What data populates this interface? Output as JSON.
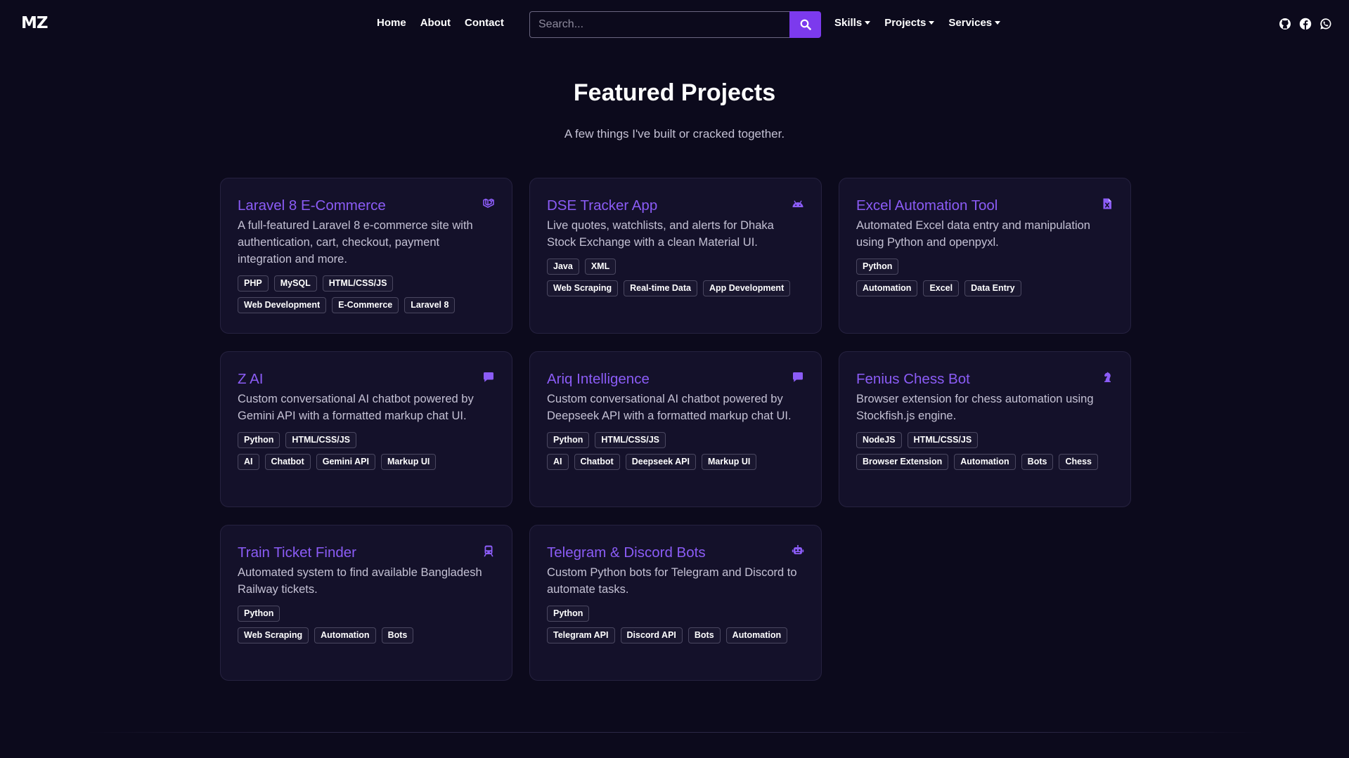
{
  "brand": {
    "logo": "MZ"
  },
  "nav": {
    "links": [
      "Home",
      "About",
      "Contact"
    ],
    "search": {
      "placeholder": "Search...",
      "value": ""
    },
    "dropdowns": [
      "Skills",
      "Projects",
      "Services"
    ],
    "socials": [
      "github-icon",
      "facebook-icon",
      "whatsapp-icon"
    ]
  },
  "colors": {
    "accent": "#7c3aed",
    "title": "#8b5cf6",
    "background": "#0c0a1c",
    "card": "#14112a"
  },
  "section": {
    "title": "Featured Projects",
    "subtitle": "A few things I've built or cracked together."
  },
  "projects": [
    {
      "title": "Laravel 8 E-Commerce",
      "icon": "laravel-icon",
      "description": "A full-featured Laravel 8 e-commerce site with authentication, cart, checkout, payment integration and more.",
      "tech": [
        "PHP",
        "MySQL",
        "HTML/CSS/JS"
      ],
      "tags": [
        "Web Development",
        "E-Commerce",
        "Laravel 8"
      ]
    },
    {
      "title": "DSE Tracker App",
      "icon": "android-icon",
      "description": "Live quotes, watchlists, and alerts for Dhaka Stock Exchange with a clean Material UI.",
      "tech": [
        "Java",
        "XML"
      ],
      "tags": [
        "Web Scraping",
        "Real-time Data",
        "App Development"
      ]
    },
    {
      "title": "Excel Automation Tool",
      "icon": "excel-file-icon",
      "description": "Automated Excel data entry and manipulation using Python and openpyxl.",
      "tech": [
        "Python"
      ],
      "tags": [
        "Automation",
        "Excel",
        "Data Entry"
      ]
    },
    {
      "title": "Z AI",
      "icon": "chat-icon",
      "description": "Custom conversational AI chatbot powered by Gemini API with a formatted markup chat UI.",
      "tech": [
        "Python",
        "HTML/CSS/JS"
      ],
      "tags": [
        "AI",
        "Chatbot",
        "Gemini API",
        "Markup UI"
      ]
    },
    {
      "title": "Ariq Intelligence",
      "icon": "chat-icon",
      "description": "Custom conversational AI chatbot powered by Deepseek API with a formatted markup chat UI.",
      "tech": [
        "Python",
        "HTML/CSS/JS"
      ],
      "tags": [
        "AI",
        "Chatbot",
        "Deepseek API",
        "Markup UI"
      ]
    },
    {
      "title": "Fenius Chess Bot",
      "icon": "chess-knight-icon",
      "description": "Browser extension for chess automation using Stockfish.js engine.",
      "tech": [
        "NodeJS",
        "HTML/CSS/JS"
      ],
      "tags": [
        "Browser Extension",
        "Automation",
        "Bots",
        "Chess"
      ]
    },
    {
      "title": "Train Ticket Finder",
      "icon": "train-icon",
      "description": "Automated system to find available Bangladesh Railway tickets.",
      "tech": [
        "Python"
      ],
      "tags": [
        "Web Scraping",
        "Automation",
        "Bots"
      ]
    },
    {
      "title": "Telegram & Discord Bots",
      "icon": "robot-icon",
      "description": "Custom Python bots for Telegram and Discord to automate tasks.",
      "tech": [
        "Python"
      ],
      "tags": [
        "Telegram API",
        "Discord API",
        "Bots",
        "Automation"
      ]
    }
  ]
}
